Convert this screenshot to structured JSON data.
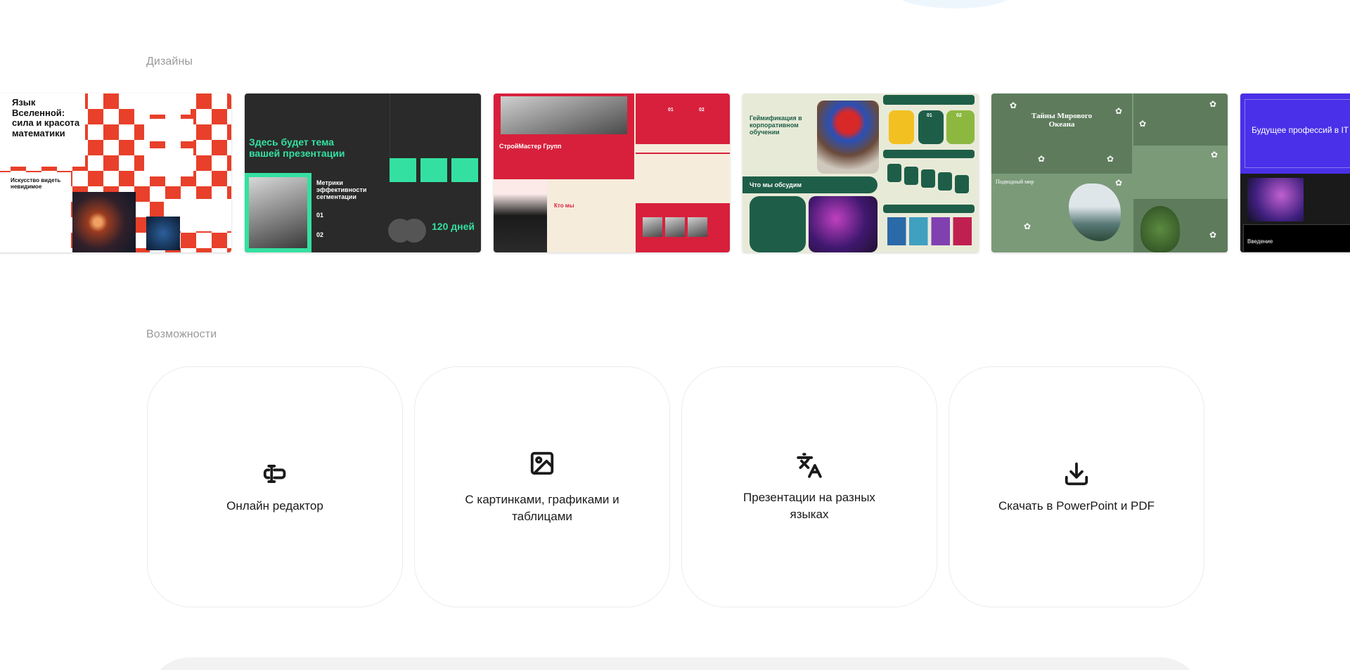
{
  "sections": {
    "designs_label": "Дизайны",
    "features_label": "Возможности"
  },
  "slides": [
    {
      "title": "Язык Вселенной: сила и красота математики",
      "subtitle": "Искусство видеть невидимое"
    },
    {
      "title": "Здесь будет тема вашей презентации",
      "subtitle": "Метрики эффективности сегментации",
      "num1": "01",
      "num2": "02",
      "stat": "120 дней"
    },
    {
      "title": "СтройМастер Групп",
      "subtitle": "Кто мы",
      "num1": "01",
      "num2": "02"
    },
    {
      "title": "Геймификация в корпоративном обучении",
      "subtitle": "Что мы обсудим",
      "badge1": "01",
      "badge2": "02"
    },
    {
      "title": "Тайны Мирового Океана",
      "subtitle": "Подводный мир"
    },
    {
      "title": "Будущее профессий в IT",
      "subtitle": "Введение"
    }
  ],
  "features": [
    {
      "icon": "text-cursor-icon",
      "label": "Онлайн редактор"
    },
    {
      "icon": "image-icon",
      "label": "С картинками, графиками и таблицами"
    },
    {
      "icon": "translate-icon",
      "label": "Презентации на разных языках"
    },
    {
      "icon": "download-icon",
      "label": "Скачать в PowerPoint и PDF"
    }
  ]
}
